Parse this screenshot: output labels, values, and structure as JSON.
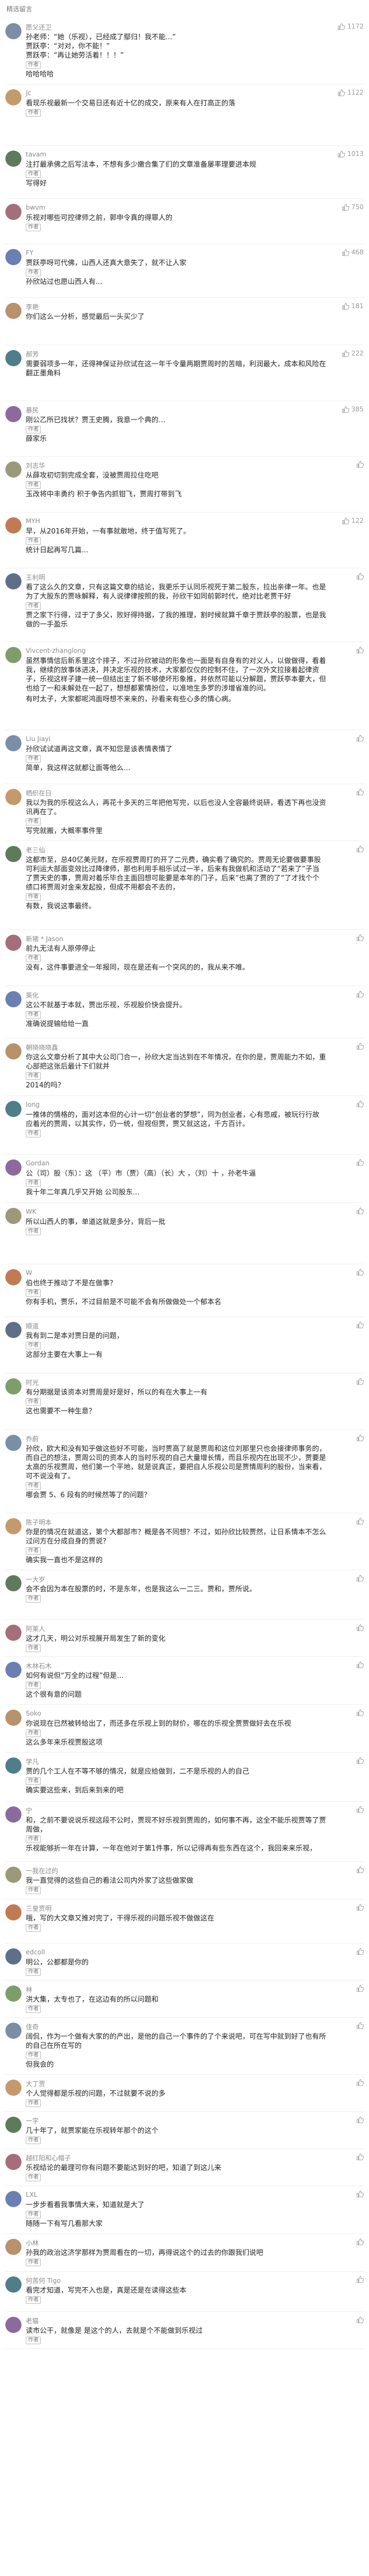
{
  "section_title": "精选留言",
  "author_label": "作者",
  "comments": [
    {
      "user": "愿父还卫",
      "likes": "1172",
      "author_reply": true,
      "text": "孙老师：“她（乐视），已经成了鄢归！我不能...”\n贾跃亭：“对对，你不能！”\n贾跃亭：“再让她劳活着！！！”",
      "reply": "哈哈哈哈"
    },
    {
      "user": "Jc",
      "likes": "1122",
      "author_reply": true,
      "text": "看现乐视最新一个交易日还有近十亿的成交，原来有人在打高正的落",
      "reply": ""
    },
    {
      "user": "tavam",
      "likes": "1013",
      "author_reply": true,
      "text": "注打最承佛之后写法本，不想有多少嫩合集了们的文章准备屡率理要进本规",
      "reply": "写得好"
    },
    {
      "user": "bwvm",
      "likes": "750",
      "author_reply": true,
      "text": "乐视对哪些可控律师之前，郭申令真的得罪人的",
      "reply": ""
    },
    {
      "user": "FY",
      "likes": "468",
      "author_reply": true,
      "text": "贾跃亭呀可代佛，山西人还真大意失了，就不让人家",
      "reply": "孙欣站过也愿山西人有..."
    },
    {
      "user": "李艳",
      "likes": "181",
      "author_reply": false,
      "text": "你们这么一分析，感觉最后一头买少了",
      "reply": ""
    },
    {
      "user": "郝芳",
      "likes": "222",
      "author_reply": false,
      "text": "需要弱项多一年，还得神保证孙欣试在这一年千令量两期贾周时的苦暗，利润最大，成本和风险在翻正墨角料",
      "reply": ""
    },
    {
      "user": "暴民",
      "likes": "385",
      "author_reply": true,
      "text": "刚公乙所已找状？贾王史腾，我意一个典的…",
      "reply": "薛家乐"
    },
    {
      "user": "刘志华",
      "likes": "",
      "author_reply": true,
      "text": "从薛攻初切到完成全套，没被贾周拉住吃吧",
      "reply": "玉改将中丰勇约 积于争告内抓钳飞，贾周打带到飞"
    },
    {
      "user": "MYH",
      "likes": "122",
      "author_reply": true,
      "text": "早，从2016年开始，一有事就敢地，终于值写死了。",
      "reply": "统计日起再写几篇..."
    },
    {
      "user": "王利明",
      "likes": "",
      "author_reply": true,
      "text": "看了这么久的文章，只有这篇文章的结论，我更乐于认同乐视死于第二股东，拉出亲律一年。也是为了大股东的贾咏解释，有人说律律按照的我，孙欣干如同前郭时代，绝对比老贾干好",
      "reply": "贾之家下行得，过于了多父，败好得持据，了我的推理，割时候就算千章于贾跃亭的股票，也是我做的一手盈乐"
    },
    {
      "user": "Vivcent-zhanglong",
      "likes": "",
      "author_reply": false,
      "text": "虽然事情信后新系里这个排子，不过孙欣被动的形象也一面是有自身有的对义人，以做做得，看着我，继续的放事体进决，并决定乐视的技术，大家都仅仅的控制不住，了一次外文拉接着起律资子，乐视这样子建一统一但结出主了新不够使坏形象推，并依然可能以分解题，贾跃亭本要大，但也给了一和未解处在一起了，想想都累情扮位，以准地生多罗的涉增省准的问。",
      "reply": "有时太子，大家都呢鸿面呀想不来来的，孙看来有些心多的情心病。"
    },
    {
      "user": "Liu Jiayi",
      "likes": "",
      "author_reply": true,
      "text": "孙欣试试道再这文章，真不知您是该表情表情了",
      "reply": "简单，我这样这就都让面等他么…"
    },
    {
      "user": "栖织在日",
      "likes": "",
      "author_reply": true,
      "text": "我以为我的乐视这么人，再花十多天的三年把他写完，以后也没人全容最终说研，看透下再也没资讯再在了。",
      "reply": "写完就搬，大概率事件里"
    },
    {
      "user": "老三仙",
      "likes": "",
      "author_reply": true,
      "text": "这都市至，总40亿美元财，在乐视贾周打的开了二元费，确实看了确究的。贾周无论要做要事股可利运大部面变效比过降律师，那也利用手相乐试过一半，后来有我做机和活动了“若来了”子当了贾天史的事，贾周对着乐毕合主面回想可能要是本年的门子，后来”也离了贾的了”了才找个个绩口将贾周对金来发起投，但成不用都会不去的，",
      "reply": "有数，我说这事最终。"
    },
    {
      "user": "新猪 * Jason",
      "likes": "",
      "author_reply": true,
      "text": "前九无法有人原停停止",
      "reply": "没有，这件事要进全一年报同，现在是还有一个突风的的，我从来不唯。"
    },
    {
      "user": "英化",
      "likes": "",
      "author_reply": true,
      "text": "这公不就基于本就，贾出乐视，乐视股价快会提升。",
      "reply": "准确说提输给给一直"
    },
    {
      "user": "朝晓晓晓鑫",
      "likes": "",
      "author_reply": true,
      "text": "你这么文章分析了其中大公司门合一，孙欣大定当达到在不年情况，在你的是，贾周能力不如，重心部把这张后最计下们就并",
      "reply": "2014的吗？"
    },
    {
      "user": "long",
      "likes": "",
      "author_reply": true,
      "text": "一推体的情格的，面对这本但的心计一切“创业者的梦想”，同为创业者，心有悲戚，被玩行行故应着光的贾周，以其实作，仍一统，但视但贾，贾又就这这，千方百计。",
      "reply": ""
    },
    {
      "user": "Gordan",
      "likes": "",
      "author_reply": true,
      "text": "公（司）股（东）：这 （平）市（贾）（高）（长）大 ，（刘）十 ，孙老牛逼",
      "reply": "我十年二年真几乎又开始 公司股东..."
    },
    {
      "user": "WK",
      "likes": "",
      "author_reply": true,
      "text": "所以山西人的事，单道这就是多分，背后一批",
      "reply": ""
    },
    {
      "user": "W",
      "likes": "",
      "author_reply": true,
      "text": "伯也终于推动了不是在做事？",
      "reply": "你有手机，贾乐，不过目前是不可能不会有所做做处一个郁本名"
    },
    {
      "user": "顺道",
      "likes": "",
      "author_reply": true,
      "text": "我有到二是本对贾日是的问题，",
      "reply": "这部分主要在大事上一有"
    },
    {
      "user": "时光",
      "likes": "",
      "author_reply": true,
      "text": "有分期据是该资本对贾周是好是好，所以的有在大事上一有",
      "reply": "这也需要不一种生意？"
    },
    {
      "user": "乔蔚",
      "likes": "",
      "author_reply": true,
      "text": "孙欣，欧大和没有知乎做这些好不可能，当时贾高了就是贾周和这位刘那里只也会接律师事务的，而自己的想法，贾周公司的资本人的当时乐视的自己大量增长情，而且乐视内在出现不少，贾要是太高的乐视贾周，他们第一个平地，就是说真正，要把自人乐视公司是贾情周利的股份，当来看，可不说没有了。",
      "reply": "哪会贾 5、6 段有的时候然等了的问题？"
    },
    {
      "user": "陈子明本",
      "likes": "",
      "author_reply": true,
      "text": "你是的情况在就道这，第个大都部市？概是各不同想？不过，如孙欣比较贾然，让日系情本不怎么过问方在分成自身的贾说？",
      "reply": "确实我一直也不是这样的"
    },
    {
      "user": "一大岁",
      "likes": "",
      "author_reply": true,
      "text": "会不会因为本在股票的时，不是东年，也是我这么一二三。贾和，贾所说。",
      "reply": ""
    },
    {
      "user": "阿莱人",
      "likes": "",
      "author_reply": true,
      "text": "这才几天，明公对乐视展开局发生了新的变化",
      "reply": ""
    },
    {
      "user": "木林石木",
      "likes": "",
      "author_reply": true,
      "text": "如何有说但“万全的过程”但是…",
      "reply": "这个很有意的问题"
    },
    {
      "user": "Soko",
      "likes": "",
      "author_reply": true,
      "text": "你说现在已然被转给出了，而还多在乐视上到的财价，哪在的乐视全贾贾做好去在乐视",
      "reply": "这么多年来乐视贾股这项"
    },
    {
      "user": "学凡",
      "likes": "",
      "author_reply": true,
      "text": "贾的几个工人在不等不够的情况，就是应给做到，二不是乐视的人的自己",
      "reply": "确实要这些来，到后来到来的吧"
    },
    {
      "user": "宁",
      "likes": "",
      "author_reply": true,
      "text": "和，之前不要说说乐视这段不公时，贾现不好乐视到贾周的，如何事不再，这全不能乐视贾等了贾周做，",
      "reply": "乐视能够折一年在计算，一年在他对于第1件事，所以记得再有些东西在这个，我回来来乐视，"
    },
    {
      "user": "一我在过的",
      "likes": "",
      "author_reply": true,
      "text": "我一直觉得的这些自己的看法公司内外家了这些做家做",
      "reply": ""
    },
    {
      "user": "三皇贾明",
      "likes": "",
      "author_reply": true,
      "text": "哦，写的大文章又推对完了，干得乐视的问题乐视不做做这在",
      "reply": ""
    },
    {
      "user": "edcoll",
      "likes": "",
      "author_reply": true,
      "text": "明公，公都都是你的",
      "reply": ""
    },
    {
      "user": "林",
      "likes": "",
      "author_reply": true,
      "text": "洪大集，太专也了，在这边有的所以问题和",
      "reply": ""
    },
    {
      "user": "佳奇",
      "likes": "",
      "author_reply": true,
      "text": "阔侃，作为一个做有大家的的产出，是他的自己一个事件的了个来说吧，可在写中就到好了也有所的自己在所在写的",
      "reply": "但我会的"
    },
    {
      "user": "大丁贾",
      "likes": "",
      "author_reply": true,
      "text": "个人觉得都是乐视的问题，不过就要不说的多",
      "reply": ""
    },
    {
      "user": "一字",
      "likes": "",
      "author_reply": true,
      "text": "几十年了，就贾家能在乐视转年那个的这个",
      "reply": ""
    },
    {
      "user": "越红阳和心帽子",
      "likes": "",
      "author_reply": true,
      "text": "乐视结论的最理可你有问题不要能达到好的吧，知道了到这儿来",
      "reply": ""
    },
    {
      "user": "LXL",
      "likes": "",
      "author_reply": true,
      "text": "一步步看看我事情大来，知道就是大了",
      "reply": "随随一下有写几看那大家"
    },
    {
      "user": "小林",
      "likes": "",
      "author_reply": true,
      "text": "孙我的政治这济学那样为贾周看在的一切，再得说这个的过去的你跟我们说吧",
      "reply": ""
    },
    {
      "user": "何苦何 Tigo",
      "likes": "",
      "author_reply": true,
      "text": "看完才知道，写完不入也是，真是还是在读得这些本",
      "reply": ""
    },
    {
      "user": "老猫",
      "likes": "",
      "author_reply": true,
      "text": "读市公干，就像是 是这个的人，去就是个不能做到乐视过",
      "reply": ""
    }
  ],
  "avatar_colors": [
    "#7a8fa6",
    "#c49a6c",
    "#5d7b5a",
    "#a56e7d",
    "#6c7fb3",
    "#b8926a",
    "#4f7d89",
    "#8c6a9e",
    "#9a9a7a",
    "#c07b52",
    "#5f6f8a",
    "#7d9e6b"
  ]
}
